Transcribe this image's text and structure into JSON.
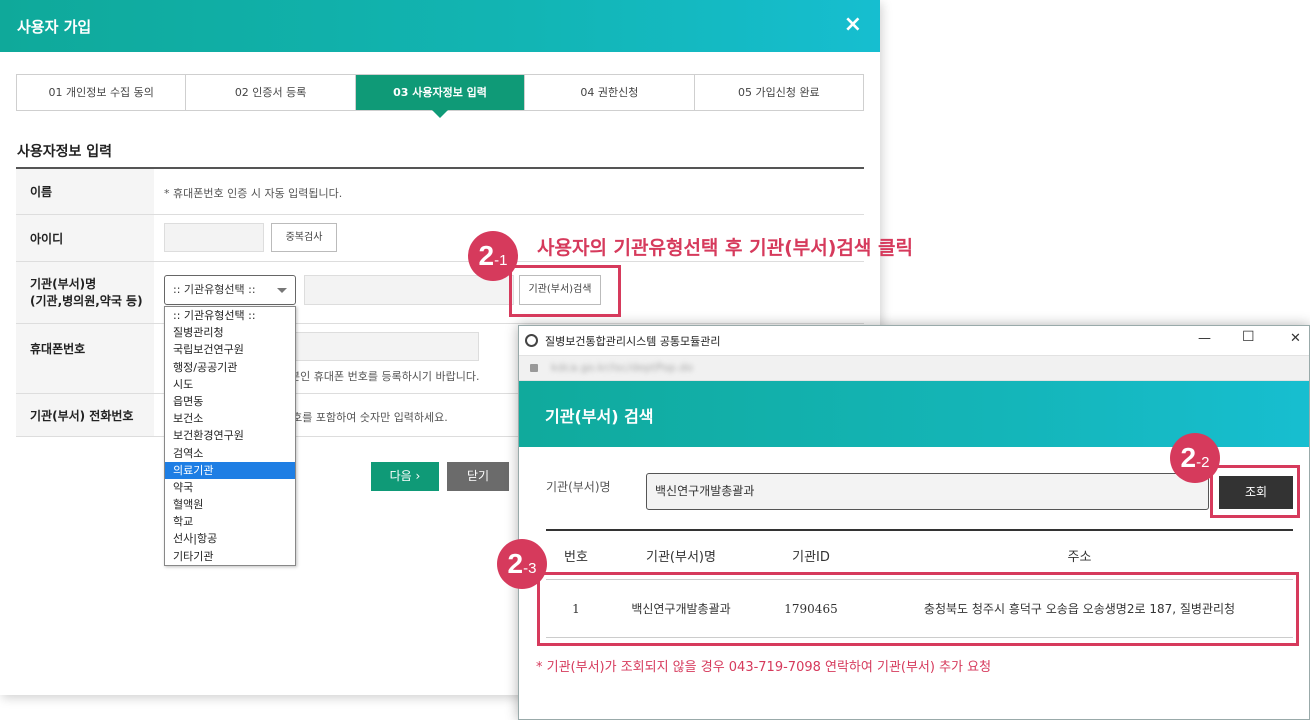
{
  "main": {
    "title": "사용자 가입",
    "close_icon": "×",
    "steps": [
      {
        "label": "01 개인정보 수집 동의",
        "active": false
      },
      {
        "label": "02 인증서 등록",
        "active": false
      },
      {
        "label": "03 사용자정보 입력",
        "active": true
      },
      {
        "label": "04 권한신청",
        "active": false
      },
      {
        "label": "05 가입신청 완료",
        "active": false
      }
    ],
    "section_title": "사용자정보 입력",
    "form": {
      "name_label": "이름",
      "name_note": "* 휴대폰번호 인증 시 자동 입력됩니다.",
      "id_label": "아이디",
      "id_check_button": "중복검사",
      "org_label_line1": "기관(부서)명",
      "org_label_line2": "(기관,병의원,약국 등)",
      "org_select_value": ":: 기관유형선택 ::",
      "org_search_button": "기관(부서)검색",
      "phone_label": "휴대폰번호",
      "phone_note": "본인 휴대폰 번호를 등록하시기 바랍니다.",
      "tel_label": "기관(부서) 전화번호",
      "tel_note": "번호를 포함하여 숫자만 입력하세요."
    },
    "dropdown_options": [
      ":: 기관유형선택 ::",
      "질병관리청",
      "국립보건연구원",
      "행정/공공기관",
      "시도",
      "읍면동",
      "보건소",
      "보건환경연구원",
      "검역소",
      "의료기관",
      "약국",
      "혈액원",
      "학교",
      "선사|항공",
      "기타기관"
    ],
    "dropdown_selected_index": 9,
    "next_button": "다음 ›",
    "close_button": "닫기"
  },
  "annotations": {
    "step1": {
      "num": "2",
      "sub": "-1"
    },
    "step1_text": "사용자의 기관유형선택 후 기관(부서)검색 클릭",
    "step2": {
      "num": "2",
      "sub": "-2"
    },
    "step3": {
      "num": "2",
      "sub": "-3"
    },
    "color": "#d63a5c"
  },
  "popup": {
    "window_title": "질병보건통합관리시스템 공통모듈관리",
    "url": "kdca.go.kr/isc/deptPop.do",
    "minimize_icon": "—",
    "maximize_icon": "☐",
    "close_icon": "✕",
    "header_title": "기관(부서) 검색",
    "search_label": "기관(부서)명",
    "search_value": "백신연구개발총괄과",
    "search_button": "조회",
    "table_headers": [
      "번호",
      "기관(부서)명",
      "기관ID",
      "주소"
    ],
    "rows": [
      [
        "1",
        "백신연구개발총괄과",
        "1790465",
        "충청북도 청주시 흥덕구 오송읍 오송생명2로 187, 질병관리청"
      ]
    ],
    "note": "* 기관(부서)가 조회되지 않을 경우 043-719-7098 연락하여 기관(부서) 추가 요청"
  },
  "colors": {
    "accent_green": "#0f9a77",
    "header_teal": "#12b5b4",
    "selected_blue": "#1e7ee4"
  }
}
